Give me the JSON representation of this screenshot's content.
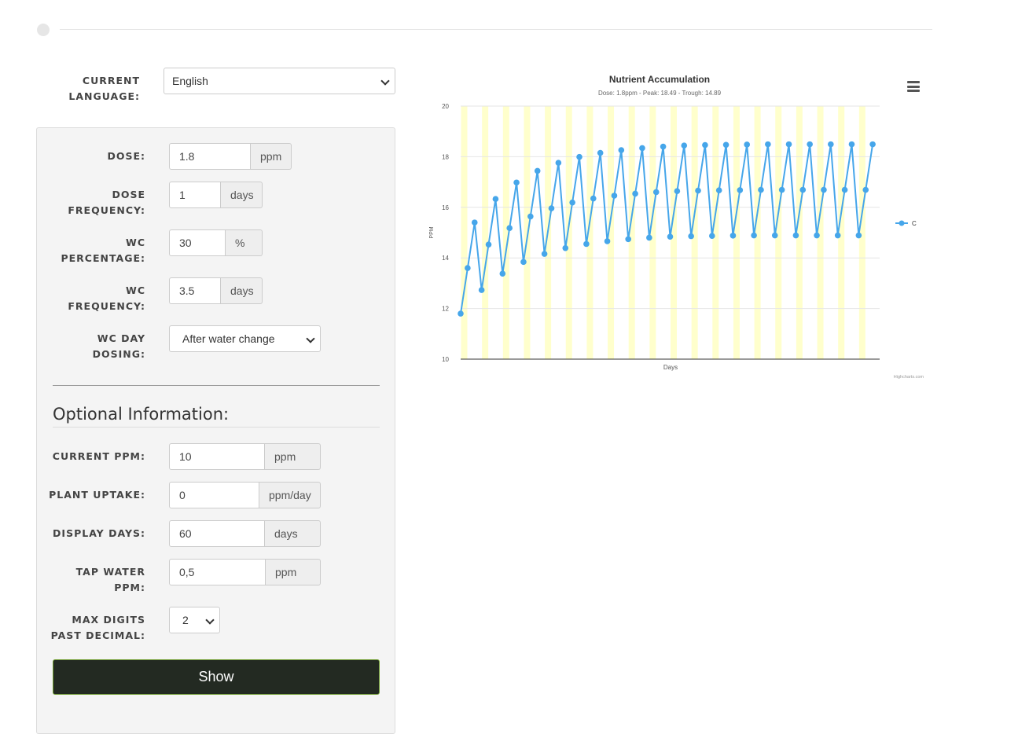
{
  "language": {
    "label": "CURRENT LANGUAGE:",
    "label_line1": "CURRENT",
    "label_line2": "LANGUAGE:",
    "value": "English"
  },
  "form": {
    "dose": {
      "label": "DOSE:",
      "value": "1.8",
      "unit": "ppm"
    },
    "dose_frequency": {
      "label_line1": "DOSE",
      "label_line2": "FREQUENCY:",
      "value": "1",
      "unit": "days"
    },
    "wc_percentage": {
      "label_line1": "WC",
      "label_line2": "PERCENTAGE:",
      "value": "30",
      "unit": "%"
    },
    "wc_frequency": {
      "label_line1": "WC",
      "label_line2": "FREQUENCY:",
      "value": "3.5",
      "unit": "days"
    },
    "wc_day_dosing": {
      "label_line1": "WC DAY",
      "label_line2": "DOSING:",
      "value": "After water change"
    }
  },
  "optional": {
    "title": "Optional Information:",
    "current_ppm": {
      "label": "CURRENT PPM:",
      "value": "10",
      "unit": "ppm"
    },
    "plant_uptake": {
      "label": "PLANT UPTAKE:",
      "value": "0",
      "unit": "ppm/day"
    },
    "display_days": {
      "label": "DISPLAY DAYS:",
      "value": "60",
      "unit": "days"
    },
    "tap_water_ppm": {
      "label_line1": "TAP WATER",
      "label_line2": "PPM:",
      "value": "0,5",
      "unit": "ppm"
    },
    "max_digits": {
      "label_line1": "MAX DIGITS",
      "label_line2": "PAST DECIMAL:",
      "value": "2"
    }
  },
  "show_button": "Show",
  "chart_data": {
    "type": "line",
    "title": "Nutrient Accumulation",
    "subtitle": "Dose: 1.8ppm - Peak: 18.49 - Trough: 14.89",
    "xlabel": "Days",
    "ylabel": "PPM",
    "ylim": [
      10,
      20
    ],
    "yticks": [
      10,
      12,
      14,
      16,
      18,
      20
    ],
    "xlim": [
      0,
      60
    ],
    "grid": true,
    "legend_position": "right",
    "credits": "Highcharts.com",
    "series": [
      {
        "name": "C",
        "color": "#46a6ea",
        "x": [
          0,
          1,
          2,
          3,
          4,
          5,
          6,
          7,
          8,
          9,
          10,
          11,
          12,
          13,
          14,
          15,
          16,
          17,
          18,
          19,
          20,
          21,
          22,
          23,
          24,
          25,
          26,
          27,
          28,
          29,
          30,
          31,
          32,
          33,
          34,
          35,
          36,
          37,
          38,
          39,
          40,
          41,
          42,
          43,
          44,
          45,
          46,
          47,
          48,
          49,
          50,
          51,
          52,
          53,
          54,
          55,
          56,
          57,
          58,
          59
        ],
        "values": [
          11.8,
          13.6,
          15.4,
          12.73,
          14.53,
          16.33,
          13.38,
          15.18,
          16.98,
          13.84,
          15.64,
          17.44,
          14.16,
          15.96,
          17.76,
          14.39,
          16.19,
          17.99,
          14.55,
          16.35,
          18.15,
          14.66,
          16.46,
          18.26,
          14.74,
          16.54,
          18.34,
          14.8,
          16.6,
          18.4,
          14.84,
          16.64,
          18.44,
          14.86,
          16.66,
          18.46,
          14.87,
          16.67,
          18.47,
          14.88,
          16.68,
          18.48,
          14.89,
          16.69,
          18.49,
          14.89,
          16.69,
          18.49,
          14.89,
          16.69,
          18.49,
          14.89,
          16.69,
          18.49,
          14.89,
          16.69,
          18.49,
          14.89,
          16.69,
          18.49
        ]
      }
    ],
    "band_color": "#ffffcc",
    "band_x": [
      0,
      3,
      6,
      9,
      12,
      15,
      18,
      21,
      24,
      27,
      30,
      33,
      36,
      39,
      42,
      45,
      48,
      51,
      54,
      57
    ]
  }
}
